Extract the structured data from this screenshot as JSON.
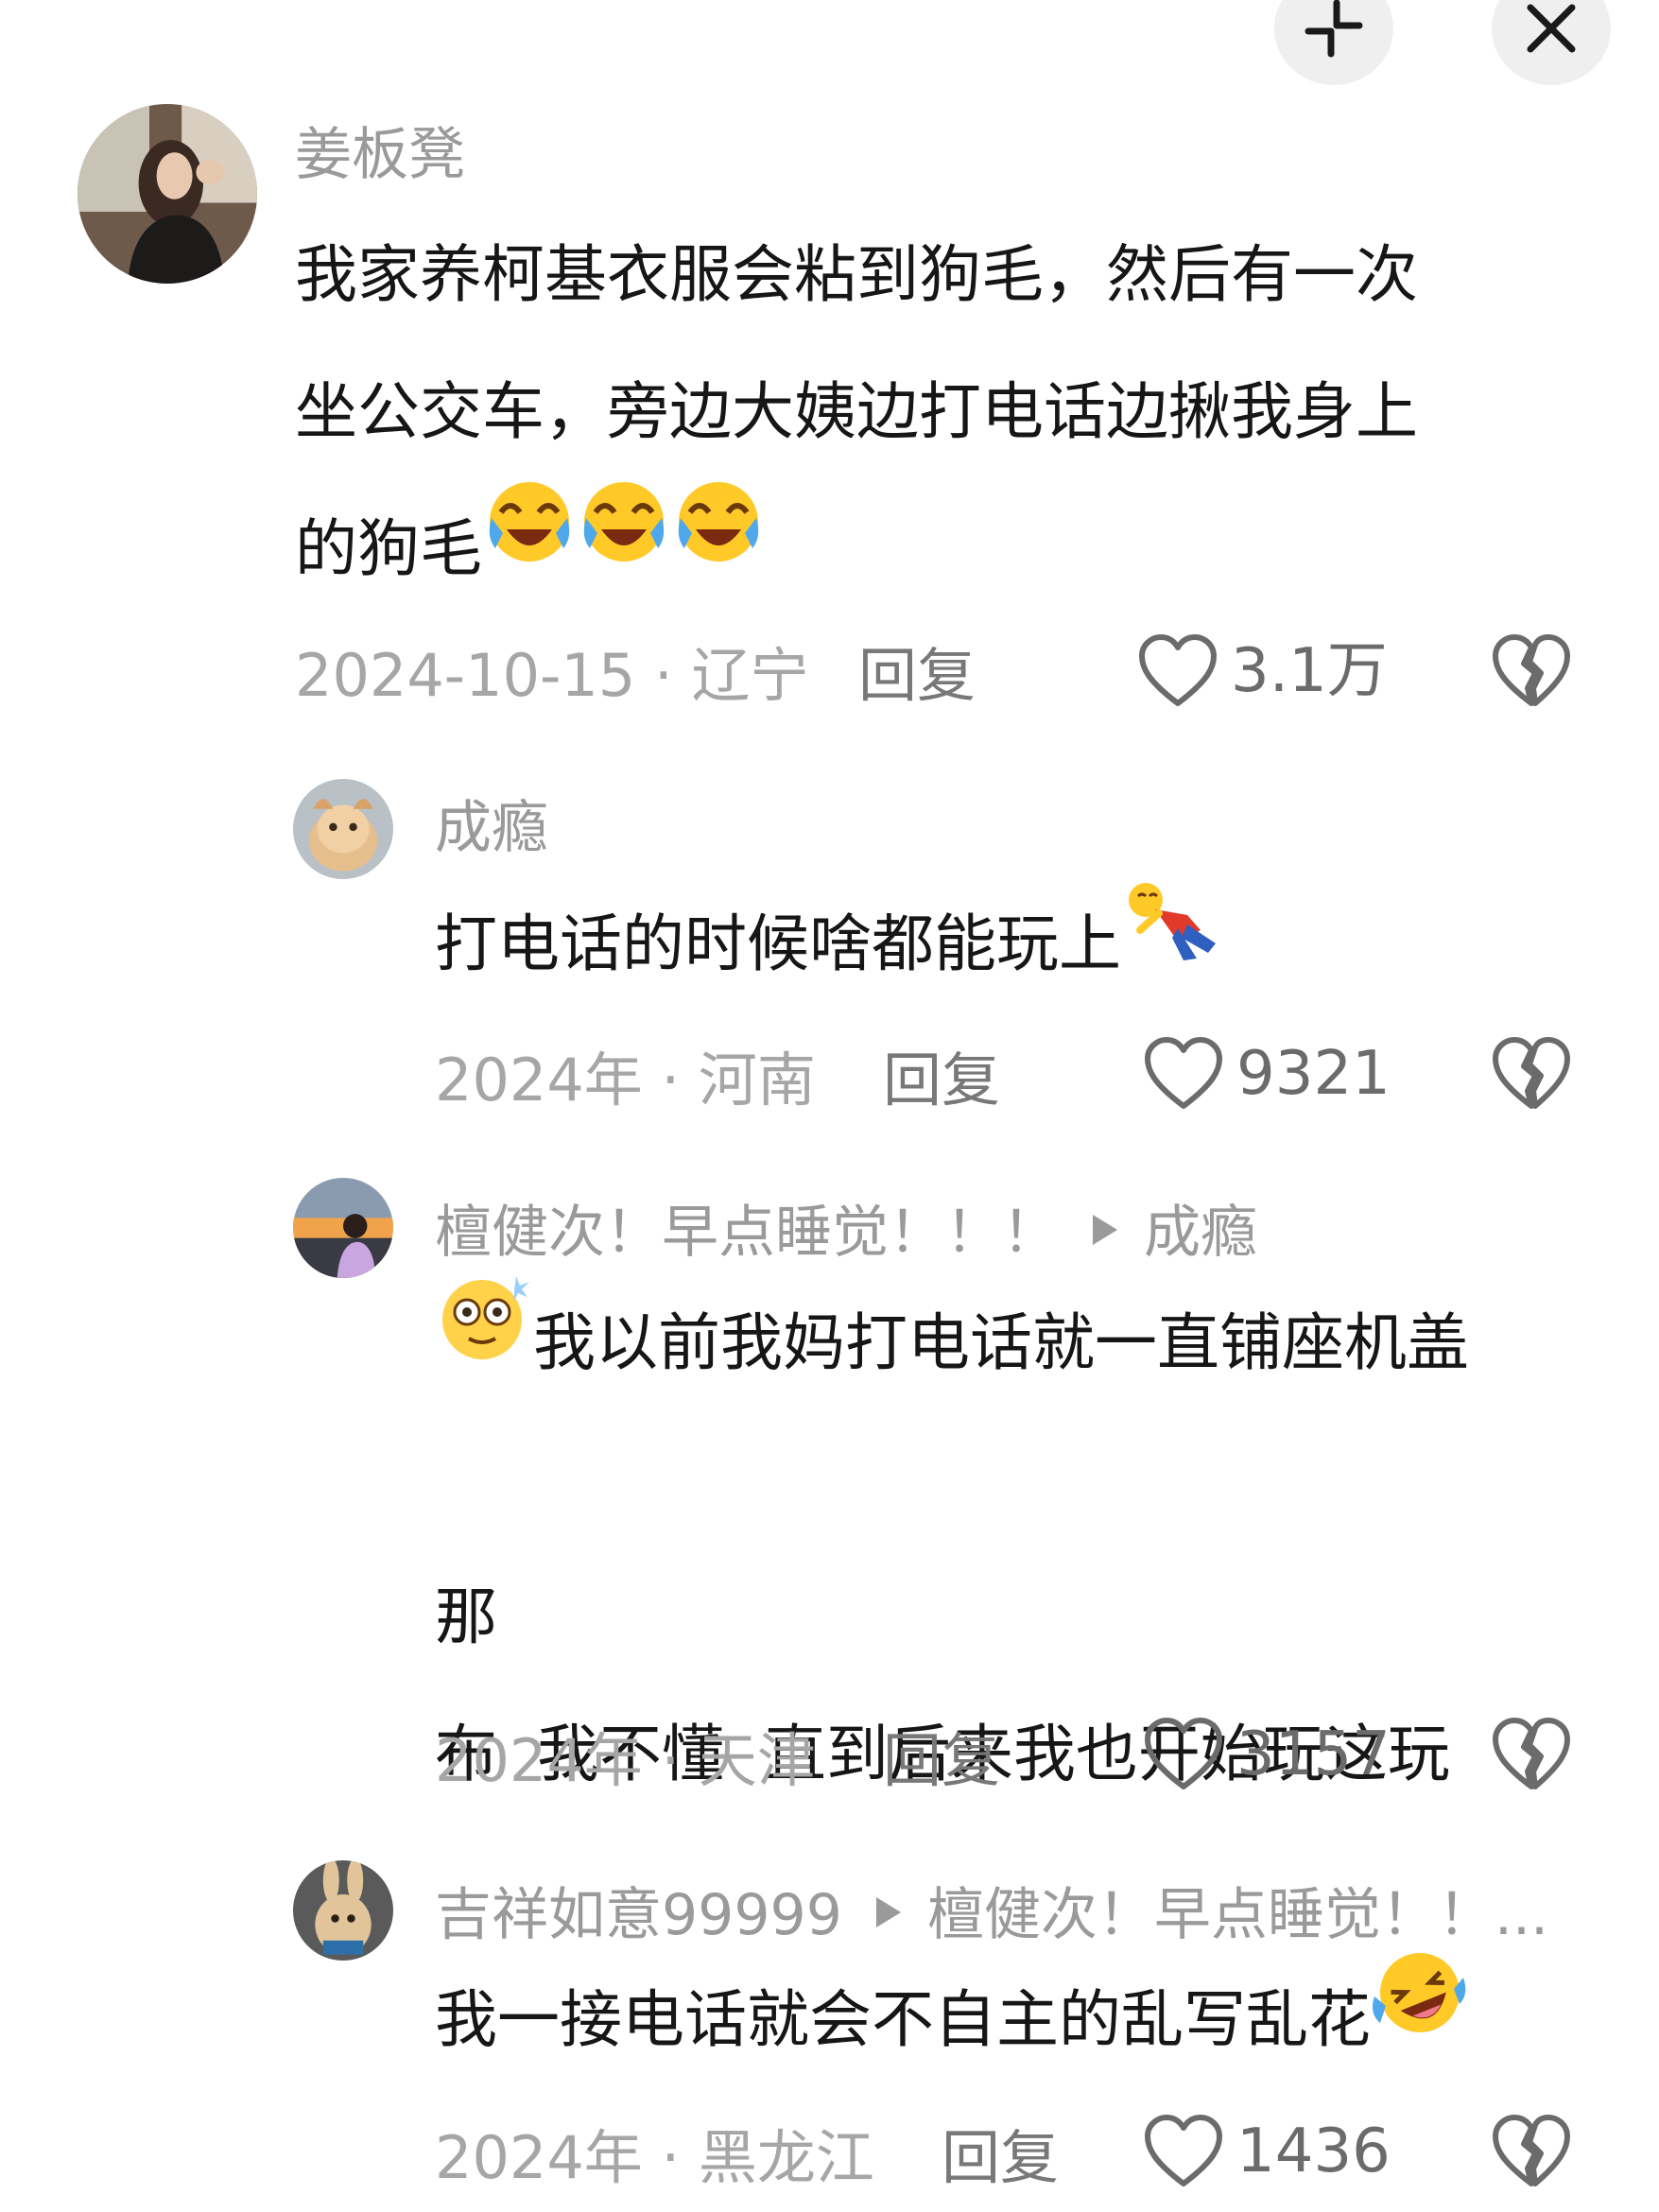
{
  "top_controls": {
    "collapse_icon": "collapse-icon",
    "close_icon": "close-icon"
  },
  "comments": [
    {
      "username": "姜板凳",
      "lines": [
        "我家养柯基衣服会粘到狗毛，然后有一次",
        "坐公交车，旁边大姨边打电话边揪我身上",
        "的狗毛"
      ],
      "emojis": [
        "crying-laughing-emoji",
        "crying-laughing-emoji",
        "crying-laughing-emoji"
      ],
      "date_location": "2024-10-15 · 辽宁",
      "reply_label": "回复",
      "likes": "3.1万"
    },
    {
      "username": "成瘾",
      "lines": [
        "打电话的时候啥都能玩上"
      ],
      "emojis": [
        "falling-person-emoji"
      ],
      "date_location": "2024年 · 河南",
      "reply_label": "回复",
      "likes": "9321"
    },
    {
      "username": "檀健次！早点睡觉！！！",
      "reply_to": "成瘾",
      "lines": [
        "我以前我妈打电话就一直铺座机盖",
        "布  我不懂  直到后来我也开始玩这玩",
        "那"
      ],
      "emojis": [
        "dizzy-face-emoji"
      ],
      "date_location": "2024年 · 天津",
      "reply_label": "回复",
      "likes": "3157"
    },
    {
      "username": "吉祥如意99999",
      "reply_to": "檀健次！早点睡觉！！...",
      "lines": [
        "我一接电话就会不自主的乱写乱花"
      ],
      "emojis": [
        "rolling-laughing-emoji"
      ],
      "date_location": "2024年 · 黑龙江",
      "reply_label": "回复",
      "likes": "1436"
    }
  ]
}
